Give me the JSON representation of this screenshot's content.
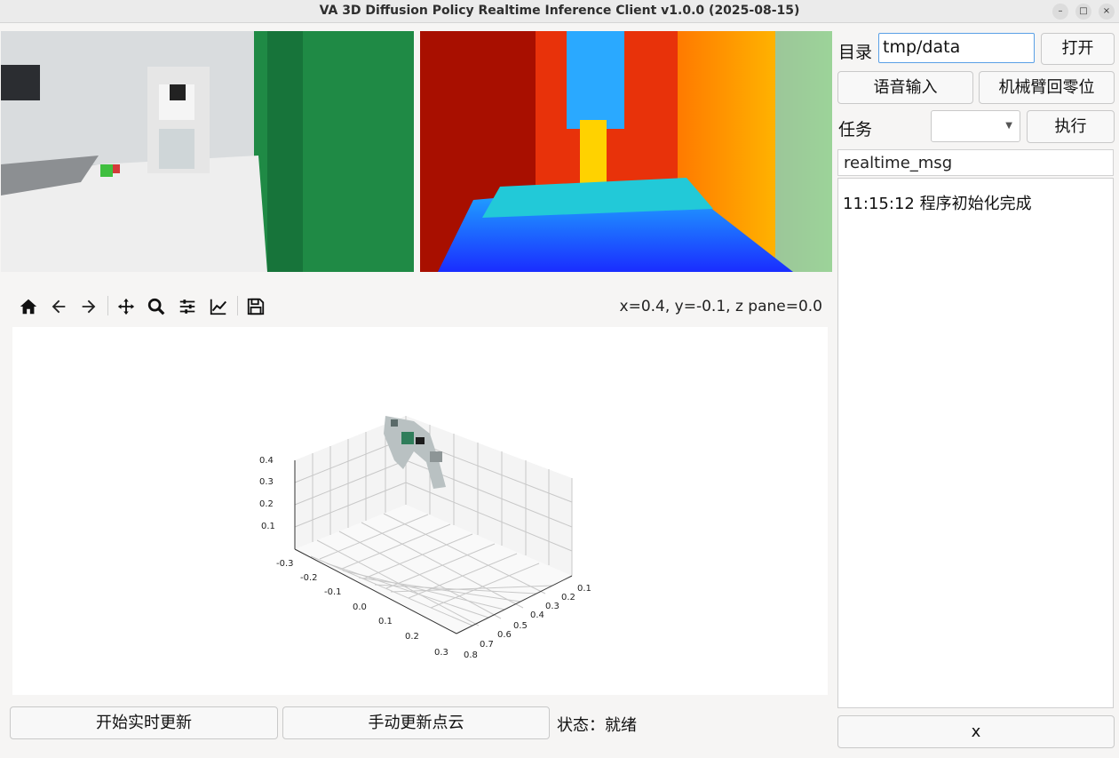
{
  "window": {
    "title": "VA 3D Diffusion Policy Realtime Inference Client v1.0.0 (2025-08-15)",
    "min_glyph": "–",
    "max_glyph": "□",
    "close_glyph": "×"
  },
  "plot": {
    "coord_readout": "x=0.4, y=-0.1, z pane=0.0",
    "z_ticks": [
      "0.4",
      "0.3",
      "0.2",
      "0.1"
    ],
    "y_ticks": [
      "-0.3",
      "-0.2",
      "-0.1",
      "0.0",
      "0.1",
      "0.2",
      "0.3"
    ],
    "x_ticks": [
      "0.1",
      "0.2",
      "0.3",
      "0.4",
      "0.5",
      "0.6",
      "0.7",
      "0.8"
    ]
  },
  "bottom": {
    "start_button": "开始实时更新",
    "manual_button": "手动更新点云",
    "status": "状态：就绪"
  },
  "right": {
    "dir_label": "目录",
    "dir_value": "tmp/data",
    "open_button": "打开",
    "voice_button": "语音输入",
    "home_button": "机械臂回零位",
    "task_label": "任务",
    "execute_button": "执行",
    "msg_header": "realtime_msg",
    "messages": [
      "11:15:12 程序初始化完成"
    ],
    "clear_button": "x"
  }
}
